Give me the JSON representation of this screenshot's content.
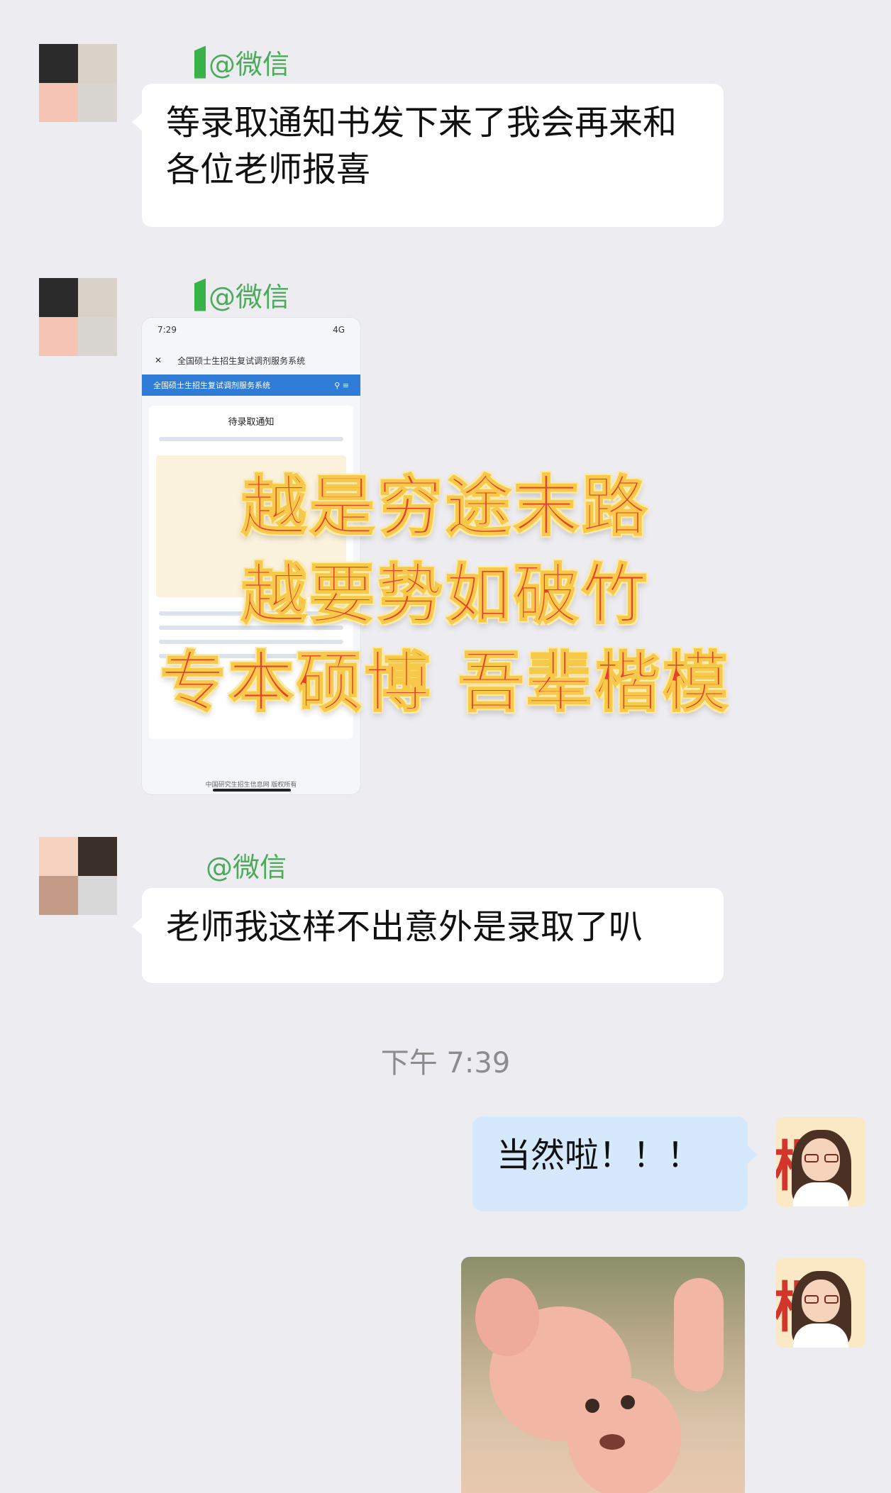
{
  "messages": [
    {
      "sender": "@微信",
      "text": "等录取通知书发下来了我会再来和各位老师报喜"
    },
    {
      "sender": "@微信",
      "image": "admission-notice-screenshot"
    },
    {
      "sender": "@微信",
      "text": "老师我这样不出意外是录取了叭"
    }
  ],
  "timestamp": "下午 7:39",
  "reply": {
    "text": "当然啦！！！",
    "sticker": "pink-bunny-sticker"
  },
  "phone_screenshot": {
    "time": "7:29",
    "status_right": "4G",
    "nav_title": "全国硕士生招生复试调剂服务系统",
    "bar_title": "全国硕士生招生复试调剂服务系统",
    "card_title": "待录取通知",
    "footer": "中国研究生招生信息网 版权所有"
  },
  "overlay": {
    "line1": "越是穷途末路",
    "line2": "越要势如破竹",
    "line3": "专本硕博 吾辈楷模"
  },
  "colors": {
    "background": "#ededf1",
    "bubble_left": "#ffffff",
    "bubble_right": "#d6e8fb",
    "sender_name": "#4caa5b",
    "slogan": "#e8402a"
  }
}
